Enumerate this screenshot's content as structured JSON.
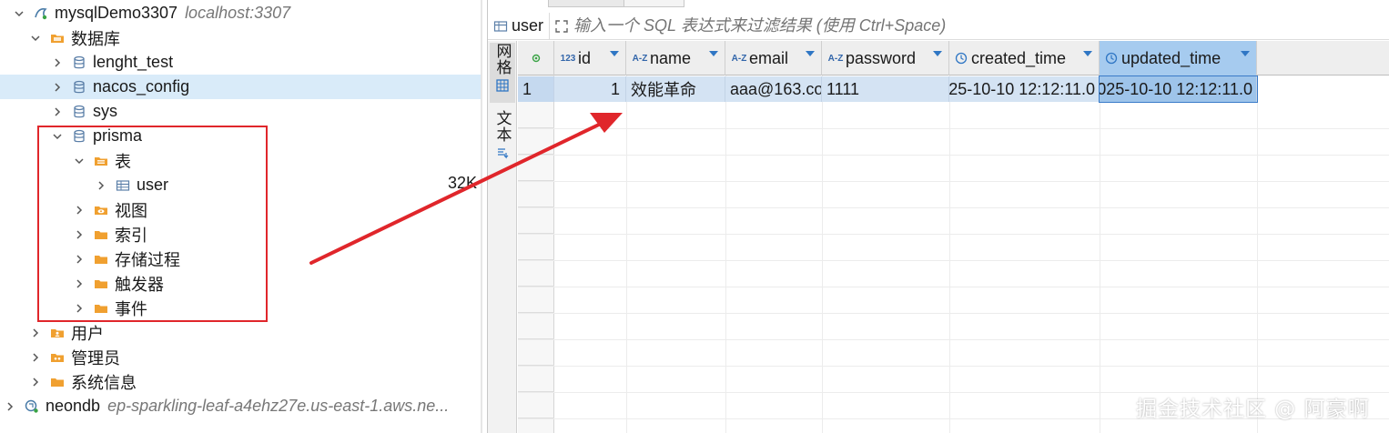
{
  "tree": {
    "connection": {
      "label": "mysqlDemo3307",
      "host": "localhost:3307"
    },
    "databases_label": "数据库",
    "databases": [
      "lenght_test",
      "nacos_config",
      "sys",
      "prisma"
    ],
    "prisma_children": {
      "tables_label": "表",
      "tables": [
        "user"
      ],
      "folders": [
        "视图",
        "索引",
        "存储过程",
        "触发器",
        "事件"
      ]
    },
    "server_folders": [
      "用户",
      "管理员",
      "系统信息"
    ],
    "connection2": {
      "label": "neondb",
      "host": "ep-sparkling-leaf-a4ehz27e.us-east-1.aws.ne..."
    },
    "size_label": "32K"
  },
  "editor": {
    "filter_table": "user",
    "filter_placeholder": "输入一个 SQL 表达式来过滤结果 (使用 Ctrl+Space)",
    "side_tabs": [
      {
        "label": "网格",
        "icon": "grid-icon"
      },
      {
        "label": "文本",
        "icon": "text-icon"
      }
    ],
    "columns": [
      {
        "name": "id",
        "type_icon": "123"
      },
      {
        "name": "name",
        "type_icon": "A-Z"
      },
      {
        "name": "email",
        "type_icon": "A-Z"
      },
      {
        "name": "password",
        "type_icon": "A-Z"
      },
      {
        "name": "created_time",
        "type_icon": "clock-icon"
      },
      {
        "name": "updated_time",
        "type_icon": "clock-icon"
      }
    ],
    "rows": [
      {
        "row_number": "1",
        "cells": [
          "1",
          "效能革命",
          "aaa@163.cor",
          "1111",
          "25-10-10 12:12:11.0",
          "025-10-10 12:12:11.0"
        ]
      }
    ]
  },
  "watermark": "掘金技术社区 @ 阿豪啊",
  "colors": {
    "selection_row": "#d9ebf9",
    "annotation_red": "#e0262b",
    "header_selected": "#a6cbef",
    "data_row": "#d4e3f3",
    "folder_orange": "#f0a030",
    "db_blue": "#5b7fa8"
  }
}
